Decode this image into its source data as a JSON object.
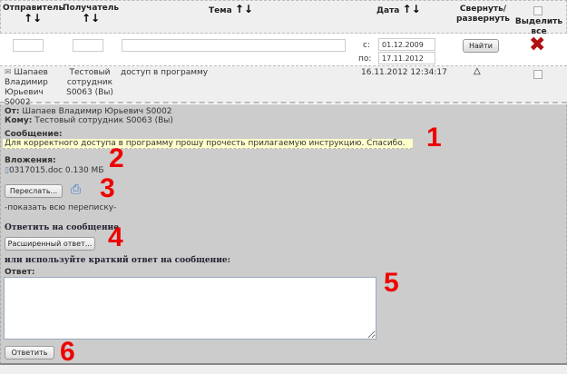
{
  "header": {
    "sender": "Отправитель",
    "recipient": "Получатель",
    "subject": "Тема",
    "date": "Дата",
    "collapse": "Свернуть/ развернуть",
    "select_all": "Выделить все",
    "sort_arrows": "↑↓"
  },
  "filter": {
    "sender_value": "",
    "recipient_value": "",
    "subject_value": "",
    "from_label": "с:",
    "from_value": "01.12.2009",
    "to_label": "по:",
    "to_value": "17.11.2012",
    "find_label": "Найти"
  },
  "message": {
    "sender": "Шапаев Владимир Юрьевич S0002",
    "recipient": "Тестовый сотрудник S0063 (Вы)",
    "subject": "доступ в программу",
    "date": "16.11.2012 12:34:17"
  },
  "detail": {
    "from_label": "От:",
    "from_value": "Шапаев Владимир Юрьевич S0002",
    "to_label": "Кому:",
    "to_value": "Тестовый сотрудник S0063 (Вы)",
    "message_label": "Сообщение:",
    "message_text": "Для корректного доступа в программу прошу прочесть прилагаемую инструкцию. Спасибо.",
    "attachments_label": "Вложения:",
    "attachment": "0317015.doc 0.130 МБ",
    "forward_label": "Переслать...",
    "show_all": "-показать всю переписку-",
    "reply_heading": "Ответить на сообщение",
    "extended_reply": "Расширенный ответ...",
    "short_reply_heading": "или используйте краткий ответ на сообщение:",
    "answer_label": "Ответ:",
    "answer_value": "",
    "reply_button": "Ответить"
  },
  "annotations": [
    "1",
    "2",
    "3",
    "4",
    "5",
    "6"
  ],
  "colors": {
    "annotation": "#ee0000",
    "panel": "#cccccc",
    "highlight": "#ffffcc"
  }
}
